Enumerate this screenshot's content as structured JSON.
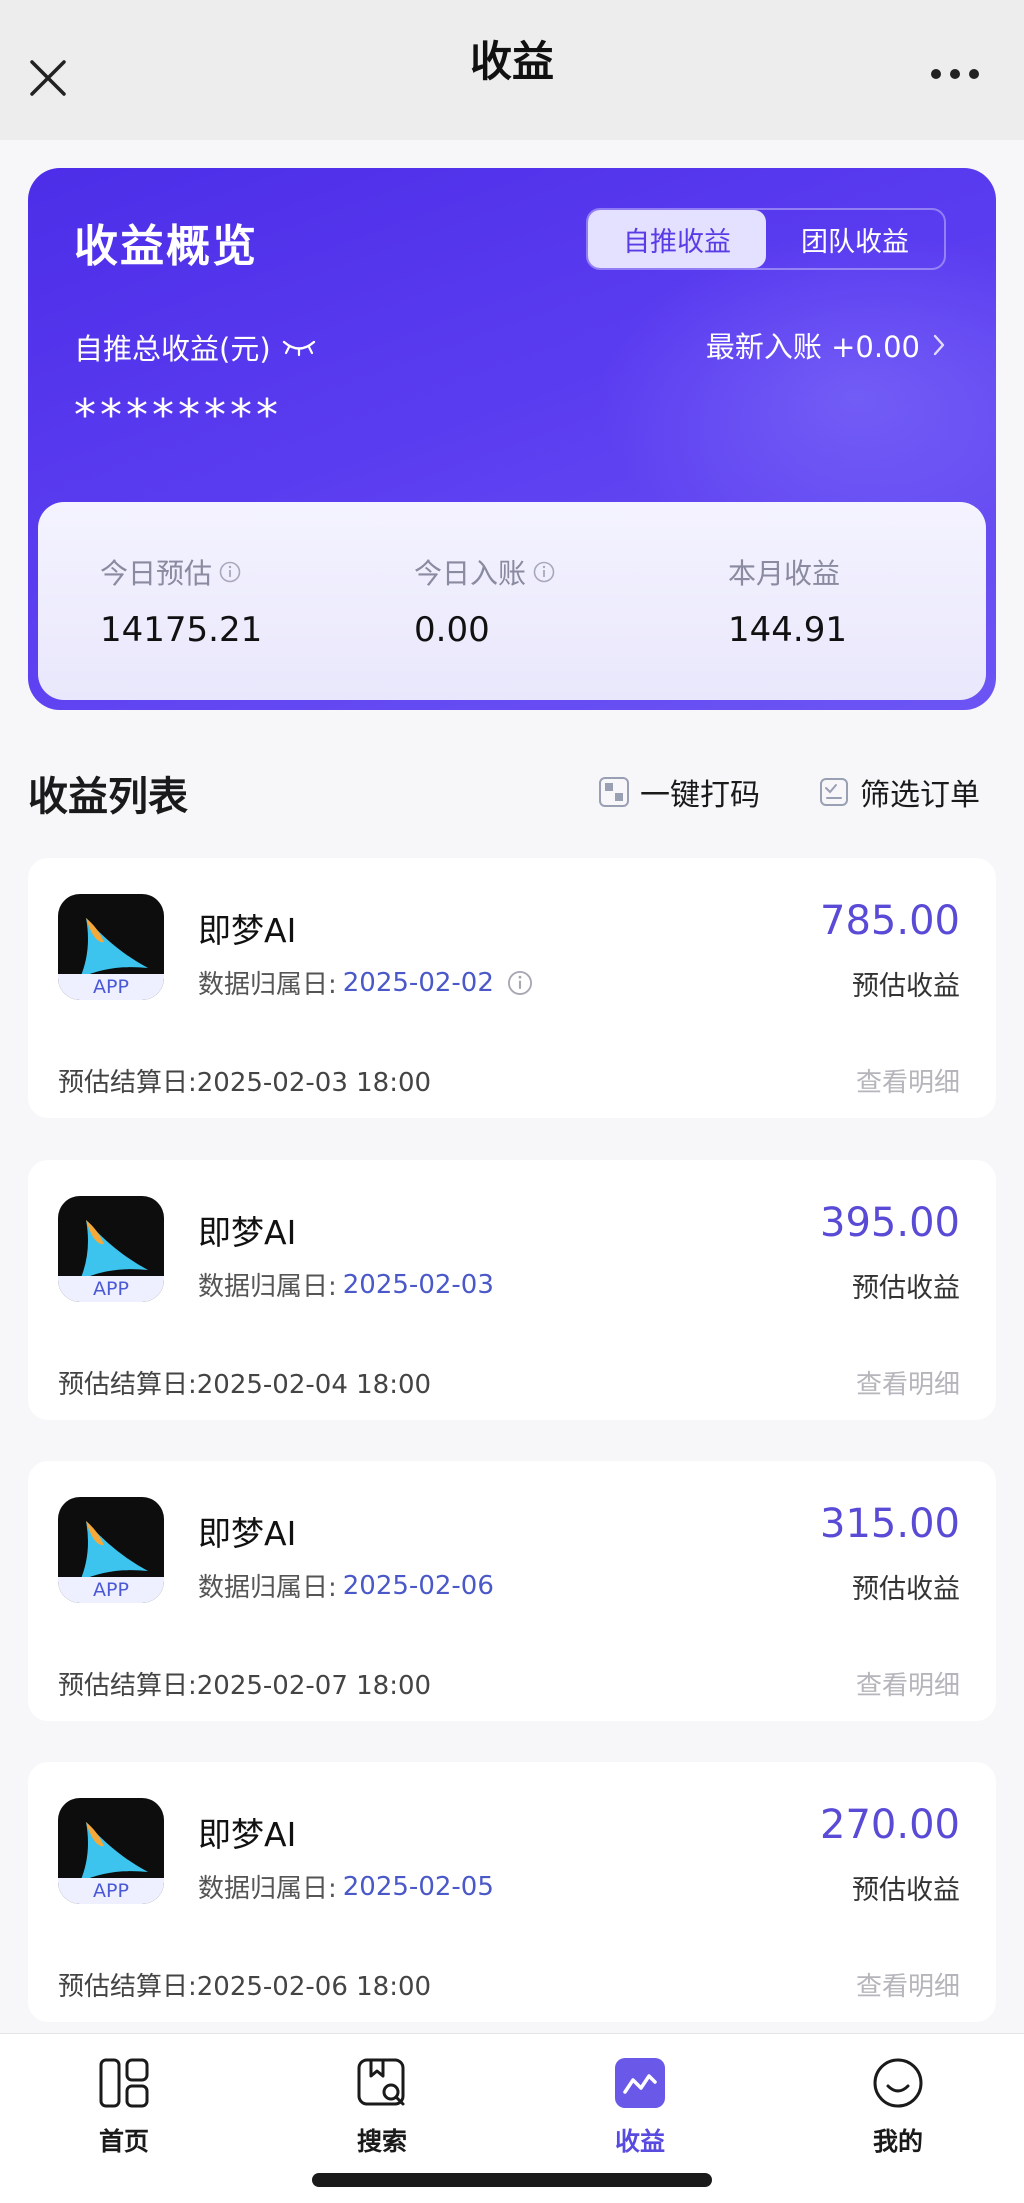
{
  "navbar": {
    "title": "收益"
  },
  "overview": {
    "title": "收益概览",
    "tabs": [
      {
        "label": "自推收益",
        "active": true
      },
      {
        "label": "团队收益",
        "active": false
      }
    ],
    "total_label": "自推总收益(元)",
    "latest_label": "最新入账 +0.00",
    "masked_value": "********",
    "stats": [
      {
        "label": "今日预估",
        "value": "14175.21",
        "has_info": true
      },
      {
        "label": "今日入账",
        "value": "0.00",
        "has_info": true
      },
      {
        "label": "本月收益",
        "value": "144.91",
        "has_info": false
      }
    ],
    "accent_color": "#5a3cf0"
  },
  "list": {
    "title": "收益列表",
    "actions": [
      {
        "label": "一键打码",
        "icon": "mosaic-icon"
      },
      {
        "label": "筛选订单",
        "icon": "filter-order-icon"
      }
    ],
    "date_prefix": "数据归属日:",
    "amount_label": "预估收益",
    "detail_label": "查看明细",
    "app_tag": "APP",
    "items": [
      {
        "app": "即梦AI",
        "date": "2025-02-02",
        "amount": "785.00",
        "settle": "预估结算日:2025-02-03 18:00",
        "has_info": true
      },
      {
        "app": "即梦AI",
        "date": "2025-02-03",
        "amount": "395.00",
        "settle": "预估结算日:2025-02-04 18:00",
        "has_info": false
      },
      {
        "app": "即梦AI",
        "date": "2025-02-06",
        "amount": "315.00",
        "settle": "预估结算日:2025-02-07 18:00",
        "has_info": false
      },
      {
        "app": "即梦AI",
        "date": "2025-02-05",
        "amount": "270.00",
        "settle": "预估结算日:2025-02-06 18:00",
        "has_info": false
      }
    ]
  },
  "tabbar": {
    "tabs": [
      {
        "label": "首页",
        "icon": "home-grid-icon",
        "active": false
      },
      {
        "label": "搜索",
        "icon": "search-image-icon",
        "active": false
      },
      {
        "label": "收益",
        "icon": "earnings-chart-icon",
        "active": true
      },
      {
        "label": "我的",
        "icon": "profile-smile-icon",
        "active": false
      }
    ],
    "active_color": "#5a4be0"
  }
}
